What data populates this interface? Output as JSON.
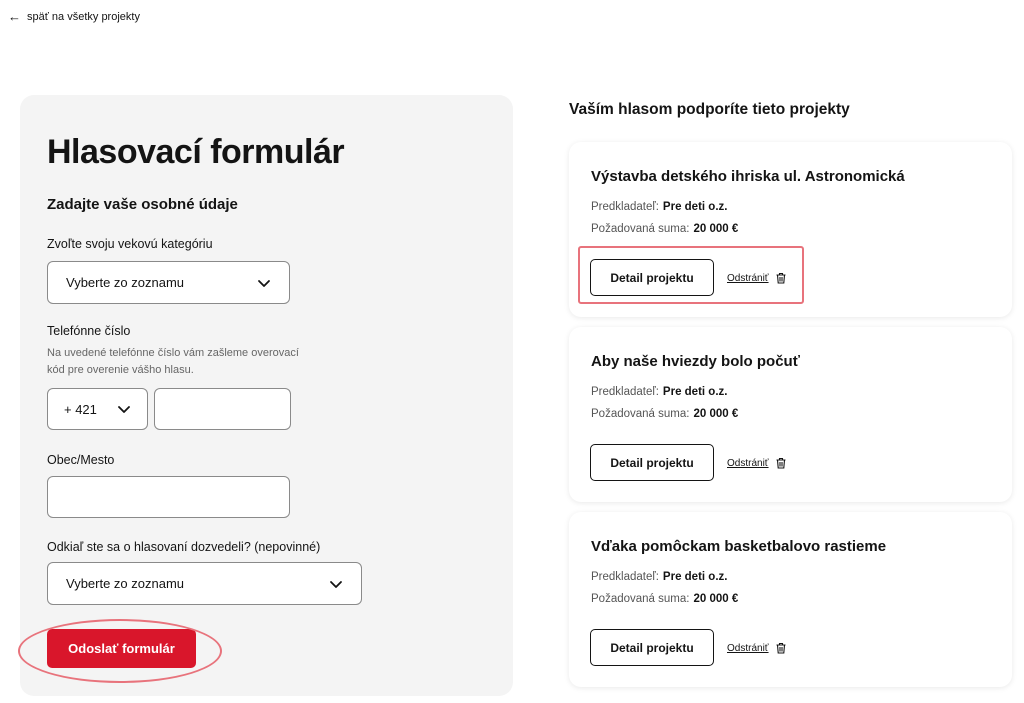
{
  "nav": {
    "back_label": "späť na všetky projekty"
  },
  "form": {
    "title": "Hlasovací formulár",
    "subtitle": "Zadajte vaše osobné údaje",
    "age": {
      "label": "Zvoľte svoju vekovú kategóriu",
      "value": "Vyberte zo zoznamu"
    },
    "phone": {
      "label": "Telefónne číslo",
      "help": "Na uvedené telefónne číslo vám zašleme overovací kód pre overenie vášho hlasu.",
      "prefix": "+ 421",
      "value": ""
    },
    "city": {
      "label": "Obec/Mesto",
      "value": ""
    },
    "source": {
      "label": "Odkiaľ ste sa o hlasovaní dozvedeli? (nepovinné)",
      "value": "Vyberte zo zoznamu"
    },
    "submit_label": "Odoslať formulár"
  },
  "projects": {
    "heading": "Vaším hlasom podporíte tieto projekty",
    "proposer_label": "Predkladateľ:",
    "amount_label": "Požadovaná suma:",
    "detail_label": "Detail projektu",
    "remove_label": "Odstrániť",
    "items": [
      {
        "title": "Výstavba detského ihriska ul. Astronomická",
        "proposer": "Pre deti o.z.",
        "amount": "20 000 €"
      },
      {
        "title": "Aby naše hviezdy bolo počuť",
        "proposer": "Pre deti o.z.",
        "amount": "20 000 €"
      },
      {
        "title": "Vďaka pomôckam basketbalovo rastieme",
        "proposer": "Pre deti o.z.",
        "amount": "20 000 €"
      }
    ]
  },
  "colors": {
    "accent": "#d9162b",
    "highlight": "#e8737c",
    "panel": "#f4f4f4"
  },
  "icons": [
    "arrow-left-icon",
    "chevron-down-icon",
    "trash-icon"
  ]
}
